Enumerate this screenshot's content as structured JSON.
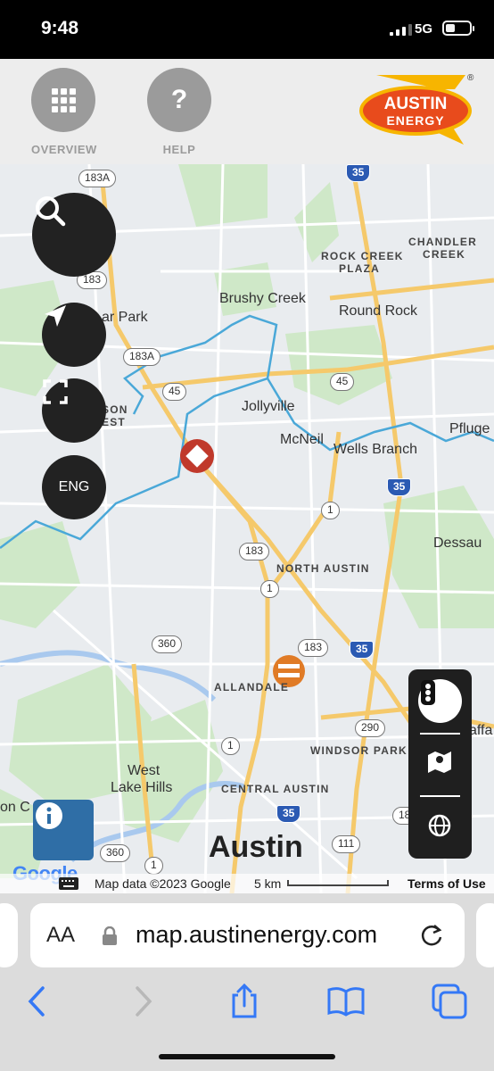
{
  "status": {
    "time": "9:48",
    "network": "5G"
  },
  "header": {
    "overview_label": "OVERVIEW",
    "help_label": "HELP",
    "logo_line1": "AUSTIN",
    "logo_line2": "ENERGY",
    "logo_mark": "®"
  },
  "map": {
    "places": [
      {
        "text": "Brushy Creek"
      },
      {
        "text": "Round Rock"
      },
      {
        "text": "ROCK CREEK"
      },
      {
        "text": "PLAZA"
      },
      {
        "text": "CHANDLER"
      },
      {
        "text": "CREEK"
      },
      {
        "text": "ar Park"
      },
      {
        "text": "Jollyville"
      },
      {
        "text": "McNeil"
      },
      {
        "text": "Wells Branch"
      },
      {
        "text": "Pfluge"
      },
      {
        "text": "SON"
      },
      {
        "text": "EST"
      },
      {
        "text": "Dessau"
      },
      {
        "text": "NORTH AUSTIN"
      },
      {
        "text": "ALLANDALE"
      },
      {
        "text": "WINDSOR PARK"
      },
      {
        "text": "West"
      },
      {
        "text": "Lake Hills"
      },
      {
        "text": "CENTRAL AUSTIN"
      },
      {
        "text": "Austin"
      },
      {
        "text": "affa"
      },
      {
        "text": "on C"
      }
    ],
    "shields": [
      "183A",
      "35",
      "183",
      "183A",
      "45",
      "45",
      "35",
      "1",
      "183",
      "1",
      "360",
      "183",
      "35",
      "290",
      "1",
      "35",
      "111",
      "360",
      "1",
      "18"
    ],
    "lang_button": "ENG",
    "attribution": {
      "map_data": "Map data ©2023 Google",
      "scale": "5 km",
      "terms": "Terms of Use",
      "google": "Google"
    },
    "colors": {
      "outage_marker": "#c0392b",
      "crew_marker": "#e07b26",
      "boundary": "#4aa8d8"
    }
  },
  "browser": {
    "aa_label": "AA",
    "url": "map.austinenergy.com"
  }
}
